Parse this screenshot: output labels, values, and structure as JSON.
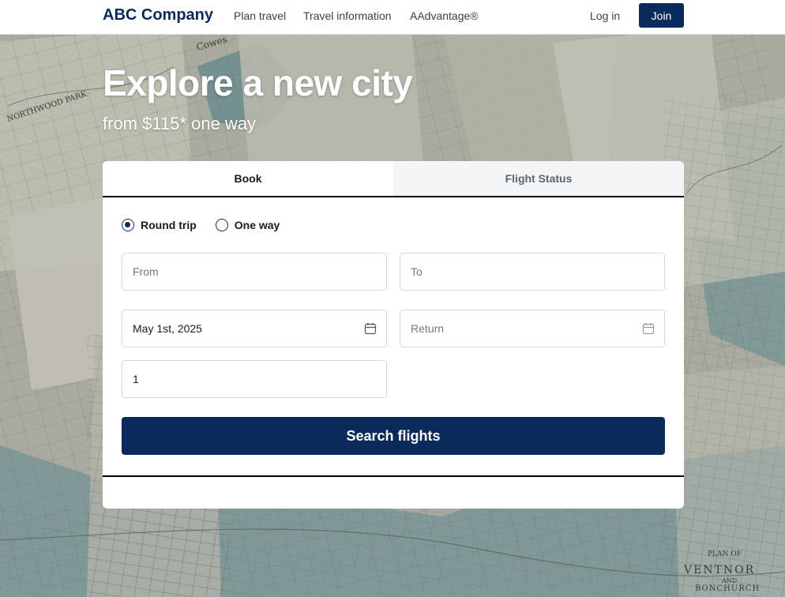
{
  "header": {
    "brand": "ABC Company",
    "nav": [
      "Plan travel",
      "Travel information",
      "AAdvantage®"
    ],
    "login_label": "Log in",
    "join_label": "Join"
  },
  "hero": {
    "headline": "Explore a new city",
    "subheadline": "from $115* one way",
    "map_text": [
      "NORTHWOOD PARK",
      "Cowes",
      "PLAN OF",
      "VENTNOR",
      "AND",
      "BONCHURCH"
    ]
  },
  "booking": {
    "tabs": [
      "Book",
      "Flight Status"
    ],
    "active_tab": "Book",
    "trip_types": [
      "Round trip",
      "One way"
    ],
    "selected_trip_type": "Round trip",
    "from_placeholder": "From",
    "to_placeholder": "To",
    "depart_value": "May 1st, 2025",
    "return_placeholder": "Return",
    "passengers_value": "1",
    "search_label": "Search flights"
  },
  "colors": {
    "brand_navy": "#0b2a5c",
    "tab_inactive_bg": "#f3f5f7"
  },
  "icons": {
    "calendar": "calendar-icon"
  }
}
